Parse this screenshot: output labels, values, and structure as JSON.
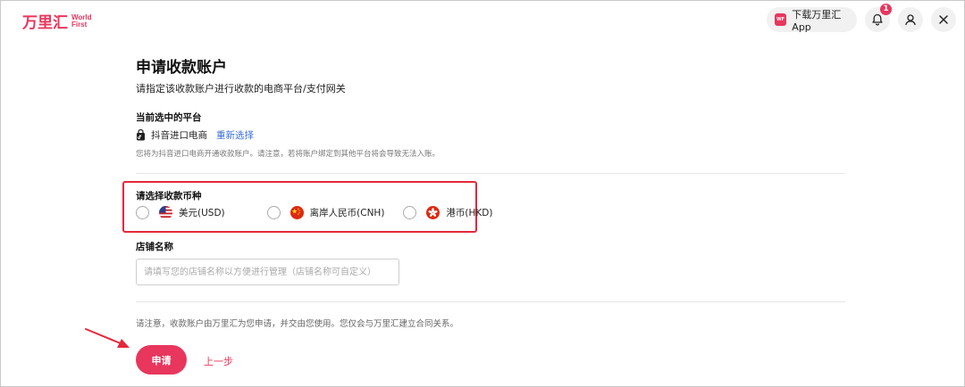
{
  "header": {
    "logo_cn": "万里汇",
    "logo_en_line1": "World",
    "logo_en_line2": "First",
    "download_app_label": "下载万里汇App",
    "app_icon_text": "World First",
    "notification_count": "1"
  },
  "page": {
    "title": "申请收款账户",
    "subtitle": "请指定该收款账户进行收款的电商平台/支付网关"
  },
  "platform": {
    "section_label": "当前选中的平台",
    "name": "抖音进口电商",
    "reselect_label": "重新选择",
    "hint": "您将为抖音进口电商开通收款账户。请注意，若将账户绑定到其他平台将会导致无法入账。"
  },
  "currency": {
    "section_label": "请选择收款币种",
    "options": [
      {
        "label": "美元(USD)",
        "flag": "us-flag"
      },
      {
        "label": "离岸人民币(CNH)",
        "flag": "cn-flag"
      },
      {
        "label": "港币(HKD)",
        "flag": "hk-flag"
      }
    ]
  },
  "store": {
    "section_label": "店铺名称",
    "placeholder": "请填写您的店铺名称以方便进行管理（店铺名称可自定义）",
    "value": ""
  },
  "footer": {
    "notice": "请注意，收款账户由万里汇为您申请，并交由您使用。您仅会与万里汇建立合同关系。",
    "apply_label": "申请",
    "back_label": "上一步"
  },
  "colors": {
    "brand": "#e8365d",
    "highlight_border": "#e5283b",
    "link": "#3a6fd8"
  }
}
